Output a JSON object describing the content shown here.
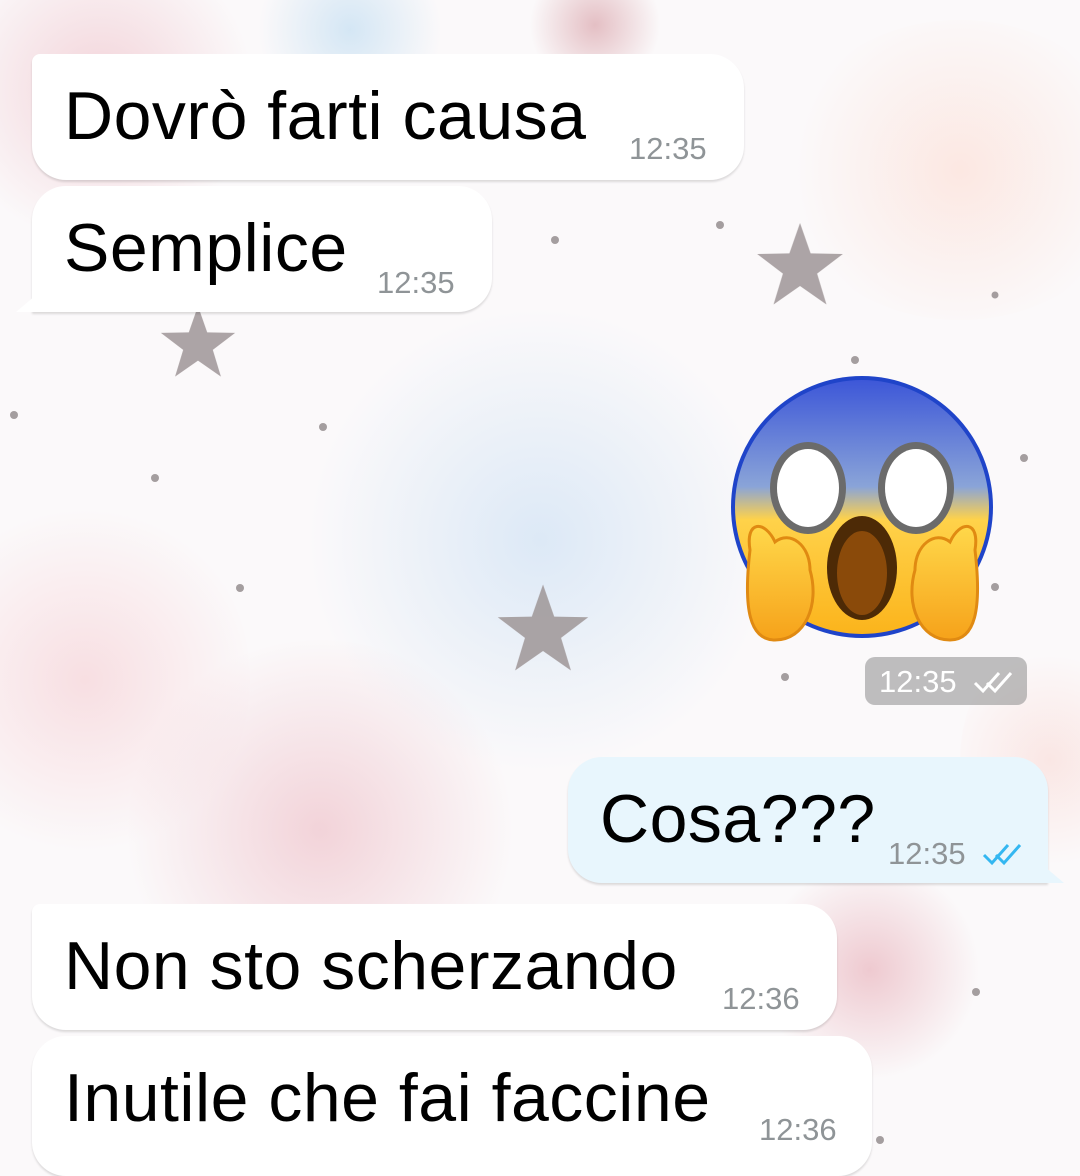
{
  "chat": {
    "messages": [
      {
        "direction": "incoming",
        "text": "Dovrò farti causa",
        "time": "12:35"
      },
      {
        "direction": "incoming",
        "text": "Semplice",
        "time": "12:35"
      },
      {
        "direction": "outgoing",
        "type": "sticker",
        "sticker": "face-screaming-in-fear-emoji",
        "time": "12:35",
        "status": "delivered"
      },
      {
        "direction": "outgoing",
        "text": "Cosa???",
        "time": "12:35",
        "status": "read"
      },
      {
        "direction": "incoming",
        "text": "Non sto scherzando",
        "time": "12:36"
      },
      {
        "direction": "incoming",
        "text": "Inutile che fai faccine",
        "time": "12:36"
      }
    ]
  },
  "colors": {
    "incoming_bubble": "#ffffff",
    "outgoing_bubble": "#e8f6fd",
    "read_ticks": "#34b7f1",
    "timestamp": "#8f9497"
  },
  "icons": {
    "read_receipt": "double-check-icon",
    "wallpaper_decoration": "star-icon"
  }
}
